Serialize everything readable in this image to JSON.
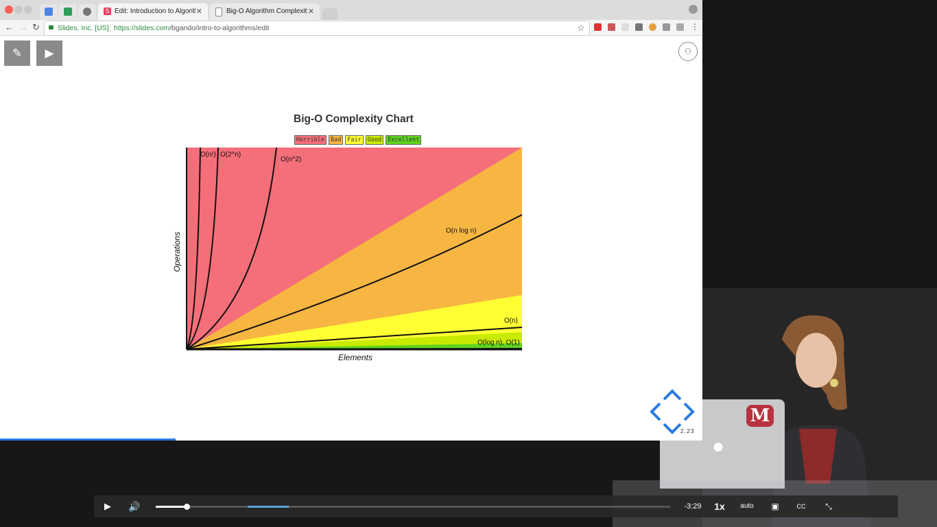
{
  "browser": {
    "tabs": [
      {
        "label": "Edit: Introduction to Algorithms",
        "active": true,
        "favicon": "S"
      },
      {
        "label": "Big-O Algorithm Complexity C",
        "active": false,
        "favicon": "doc-icon"
      }
    ],
    "address": {
      "secure_label": "Slides, Inc. [US]",
      "url_host": "https://slides.com",
      "url_path": "/bgando/intro-to-algorithms/edit"
    }
  },
  "slide": {
    "chart_title": "Big-O Complexity Chart",
    "legend": [
      {
        "label": "Horrible",
        "color": "#f56f7a"
      },
      {
        "label": "Bad",
        "color": "#f7b642"
      },
      {
        "label": "Fair",
        "color": "#ffff33"
      },
      {
        "label": "Good",
        "color": "#c8ea00"
      },
      {
        "label": "Excellent",
        "color": "#5fd321"
      }
    ],
    "page_number": "2.23"
  },
  "chart_data": {
    "type": "line",
    "title": "Big-O Complexity Chart",
    "xlabel": "Elements",
    "ylabel": "Operations",
    "grid": false,
    "legend_position": "top-center",
    "series": [
      {
        "name": "O(n!)"
      },
      {
        "name": "O(2^n)"
      },
      {
        "name": "O(n^2)"
      },
      {
        "name": "O(n log n)"
      },
      {
        "name": "O(n)"
      },
      {
        "name": "O(log n), O(1)"
      }
    ]
  },
  "video": {
    "time_remaining": "-3:29",
    "speed": "1x",
    "quality": "auto",
    "played_fraction": 0.06,
    "buffer_fraction": 0.26
  },
  "colors": {
    "horrible": "#f56f7a",
    "bad": "#f7b642",
    "fair": "#ffff33",
    "good": "#c8ea00",
    "excellent": "#5fd321",
    "accent": "#2a7ae2"
  }
}
